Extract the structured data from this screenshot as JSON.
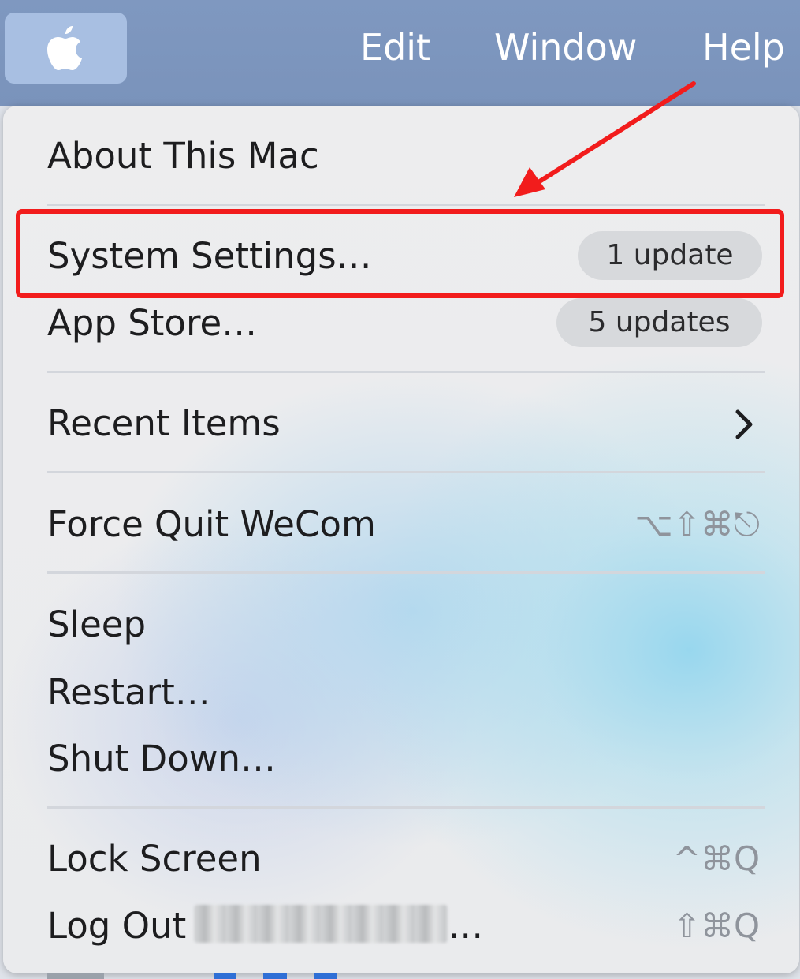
{
  "menubar": {
    "logo_icon": "apple-logo-icon",
    "items": [
      {
        "label": "Edit"
      },
      {
        "label": "Window"
      },
      {
        "label": "Help"
      }
    ]
  },
  "apple_menu": {
    "about": "About This Mac",
    "system_settings": {
      "label": "System Settings…",
      "badge": "1 update"
    },
    "app_store": {
      "label": "App Store…",
      "badge": "5 updates"
    },
    "recent_items": {
      "label": "Recent Items",
      "icon": "chevron-right-icon"
    },
    "force_quit": {
      "label": "Force Quit WeCom",
      "shortcut": "⌥⇧⌘⎋"
    },
    "sleep": "Sleep",
    "restart": "Restart…",
    "shut_down": "Shut Down…",
    "lock_screen": {
      "label": "Lock Screen",
      "shortcut": "^⌘Q"
    },
    "log_out": {
      "label": "Log Out",
      "suffix": "…",
      "shortcut": "⇧⌘Q"
    }
  },
  "annotation": {
    "highlight_color": "#f21c1c"
  }
}
